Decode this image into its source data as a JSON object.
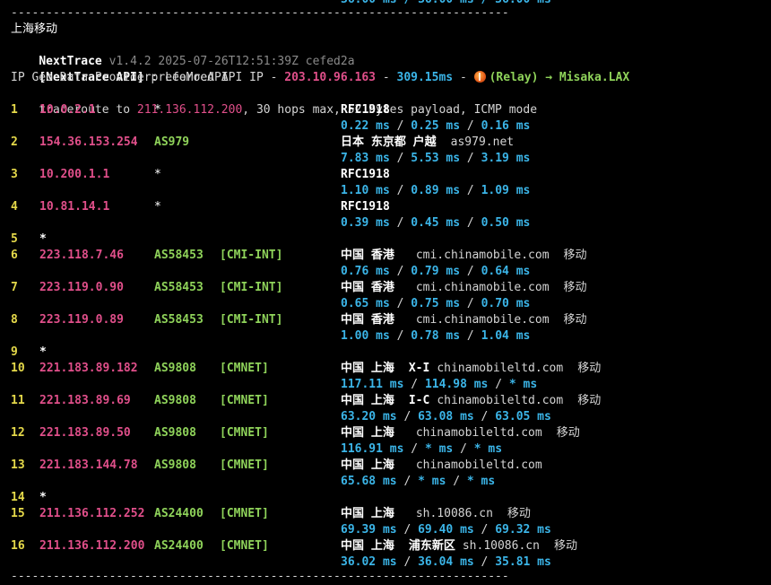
{
  "header": {
    "partial_top": "36.00 ms / 36.00 ms / 36.00 ms",
    "divider_top": "-----------------------------------------------------------------------",
    "region_title": "上海移动",
    "app_name": "NextTrace",
    "app_meta": "v1.4.2 2025-07-26T12:51:39Z cefed2a",
    "api_label": "[NextTrace API]",
    "api_pref": "preferred API IP -",
    "api_ip": "203.10.96.163",
    "api_dash": "-",
    "api_latency": "309.15ms",
    "api_dash2": "-",
    "relay_icon": "wrench-hammer-icon",
    "relay_text": "(Relay) → Misaka.LAX",
    "provider_line": "IP Geo Data Provider: LeoMoeAPI",
    "trace_prefix": "traceroute to",
    "trace_target": "211.136.112.200",
    "trace_suffix": ", 30 hops max, 52 bytes payload, ICMP mode",
    "divider_bottom": "-----------------------------------------------------------------------"
  },
  "hops": [
    {
      "n": "1",
      "ip": "10.0.2.1",
      "asn": "*",
      "tag": "",
      "geo": "RFC1918",
      "host": "",
      "isp": "",
      "lat": [
        "0.22 ms",
        "0.25 ms",
        "0.16 ms"
      ]
    },
    {
      "n": "2",
      "ip": "154.36.153.254",
      "asn": "AS979",
      "tag": "",
      "geo": "日本 东京都 户越",
      "host": "as979.net",
      "isp": "",
      "lat": [
        "7.83 ms",
        "5.53 ms",
        "3.19 ms"
      ]
    },
    {
      "n": "3",
      "ip": "10.200.1.1",
      "asn": "*",
      "tag": "",
      "geo": "RFC1918",
      "host": "",
      "isp": "",
      "lat": [
        "1.10 ms",
        "0.89 ms",
        "1.09 ms"
      ]
    },
    {
      "n": "4",
      "ip": "10.81.14.1",
      "asn": "*",
      "tag": "",
      "geo": "RFC1918",
      "host": "",
      "isp": "",
      "lat": [
        "0.39 ms",
        "0.45 ms",
        "0.50 ms"
      ]
    },
    {
      "n": "5",
      "ip": "*"
    },
    {
      "n": "6",
      "ip": "223.118.7.46",
      "asn": "AS58453",
      "tag": "[CMI-INT]",
      "geo": "中国 香港",
      "host": "cmi.chinamobile.com",
      "isp": "移动",
      "lat": [
        "0.76 ms",
        "0.79 ms",
        "0.64 ms"
      ]
    },
    {
      "n": "7",
      "ip": "223.119.0.90",
      "asn": "AS58453",
      "tag": "[CMI-INT]",
      "geo": "中国 香港",
      "host": "cmi.chinamobile.com",
      "isp": "移动",
      "lat": [
        "0.65 ms",
        "0.75 ms",
        "0.70 ms"
      ]
    },
    {
      "n": "8",
      "ip": "223.119.0.89",
      "asn": "AS58453",
      "tag": "[CMI-INT]",
      "geo": "中国 香港",
      "host": "cmi.chinamobile.com",
      "isp": "移动",
      "lat": [
        "1.00 ms",
        "0.78 ms",
        "1.04 ms"
      ]
    },
    {
      "n": "9",
      "ip": "*"
    },
    {
      "n": "10",
      "ip": "221.183.89.182",
      "asn": "AS9808",
      "tag": "[CMNET]",
      "geo": "中国 上海",
      "geo2": "X-I",
      "host": "chinamobileltd.com",
      "isp": "移动",
      "lat": [
        "117.11 ms",
        "114.98 ms",
        "* ms"
      ]
    },
    {
      "n": "11",
      "ip": "221.183.89.69",
      "asn": "AS9808",
      "tag": "[CMNET]",
      "geo": "中国 上海",
      "geo2": "I-C",
      "host": "chinamobileltd.com",
      "isp": "移动",
      "lat": [
        "63.20 ms",
        "63.08 ms",
        "63.05 ms"
      ]
    },
    {
      "n": "12",
      "ip": "221.183.89.50",
      "asn": "AS9808",
      "tag": "[CMNET]",
      "geo": "中国 上海",
      "host": "chinamobileltd.com",
      "isp": "移动",
      "lat": [
        "116.91 ms",
        "* ms",
        "* ms"
      ]
    },
    {
      "n": "13",
      "ip": "221.183.144.78",
      "asn": "AS9808",
      "tag": "[CMNET]",
      "geo": "中国 上海",
      "host": "chinamobileltd.com",
      "isp": "",
      "lat": [
        "65.68 ms",
        "* ms",
        "* ms"
      ]
    },
    {
      "n": "14",
      "ip": "*"
    },
    {
      "n": "15",
      "ip": "211.136.112.252",
      "asn": "AS24400",
      "tag": "[CMNET]",
      "geo": "中国 上海",
      "host": "sh.10086.cn",
      "isp": "移动",
      "lat": [
        "69.39 ms",
        "69.40 ms",
        "69.32 ms"
      ]
    },
    {
      "n": "16",
      "ip": "211.136.112.200",
      "asn": "AS24400",
      "tag": "[CMNET]",
      "geo": "中国 上海",
      "geo2": "浦东新区",
      "host": "sh.10086.cn",
      "isp": "移动",
      "lat": [
        "36.02 ms",
        "36.04 ms",
        "35.81 ms"
      ]
    }
  ]
}
